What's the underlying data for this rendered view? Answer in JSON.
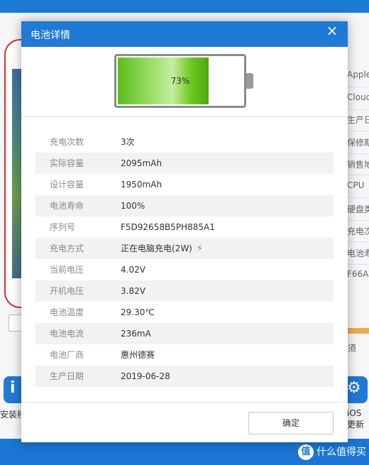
{
  "dialog": {
    "title": "电池详情",
    "close_icon": "×",
    "battery": {
      "percent_label": "73%",
      "level": 0.73
    },
    "rows": [
      {
        "label": "充电次数",
        "value": "3次"
      },
      {
        "label": "实际容量",
        "value": "2095mAh"
      },
      {
        "label": "设计容量",
        "value": "1950mAh"
      },
      {
        "label": "电池寿命",
        "value": "100%"
      },
      {
        "label": "序列号",
        "value": "F5D92658B5PH885A1"
      },
      {
        "label": "充电方式",
        "value": "正在电脑充电(2W)"
      },
      {
        "label": "当前电压",
        "value": "4.02V"
      },
      {
        "label": "开机电压",
        "value": "3.82V"
      },
      {
        "label": "电池温度",
        "value": "29.30℃"
      },
      {
        "label": "电池电流",
        "value": "236mA"
      },
      {
        "label": "电池厂商",
        "value": "惠州德赛"
      },
      {
        "label": "生产日期",
        "value": "2019-06-28"
      }
    ],
    "ok_label": "确定"
  },
  "background": {
    "right_items": [
      "Apple",
      "Cloud",
      "生产日",
      "保修期",
      "销售地",
      "CPU",
      "硬盘类",
      "充电次",
      "电池寿",
      "F66A"
    ],
    "right_text": "须",
    "tool_left_label": "安装移",
    "tool_right_label": "iOS更新",
    "watermark": "什么值得买"
  },
  "colors": {
    "accent": "#1f7ad6",
    "battery_green": "#5cbf19",
    "bolt": "#3fbf3f"
  }
}
